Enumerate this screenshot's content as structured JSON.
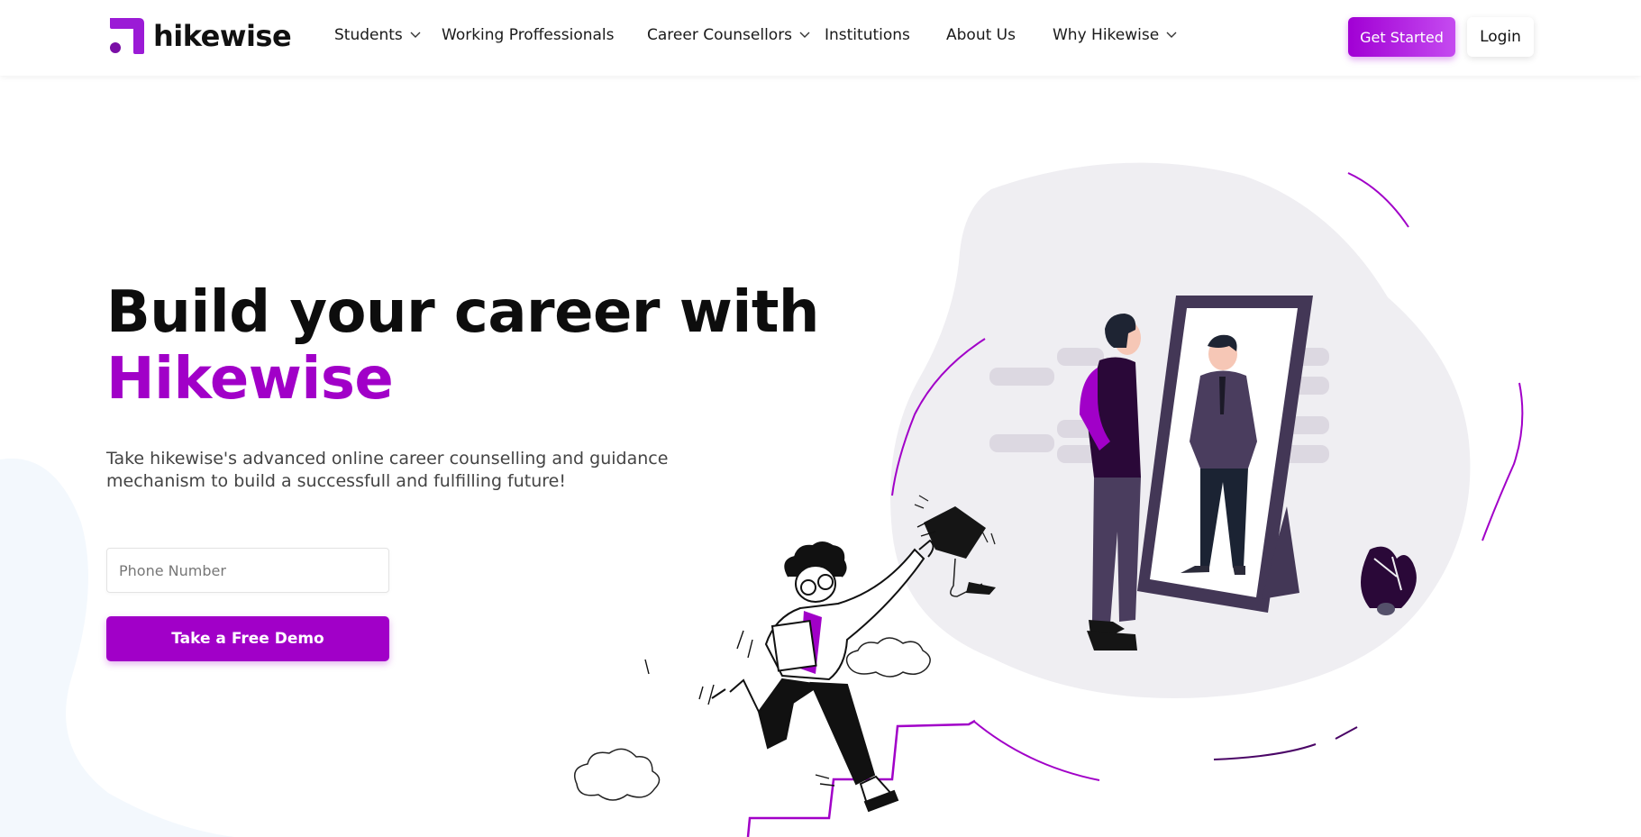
{
  "brand": {
    "name": "hikewise",
    "primary_color": "#a100c8",
    "logo_color": "#9b1bd6"
  },
  "nav": {
    "items": [
      {
        "label": "Students",
        "has_dropdown": true
      },
      {
        "label": "Working Proffessionals",
        "has_dropdown": false
      },
      {
        "label": "Career Counsellors",
        "has_dropdown": true
      },
      {
        "label": "Institutions",
        "has_dropdown": false
      },
      {
        "label": "About Us",
        "has_dropdown": false
      },
      {
        "label": "Why Hikewise",
        "has_dropdown": true
      }
    ],
    "get_started_label": "Get Started",
    "login_label": "Login"
  },
  "hero": {
    "headline_line1": "Build your career with",
    "headline_accent": "Hikewise",
    "subtext": "Take hikewise's advanced online career counselling and guidance mechanism to build a successfull and fulfilling future!",
    "phone_placeholder": "Phone Number",
    "demo_button_label": "Take a Free Demo"
  },
  "illustration": {
    "icons": [
      "student-running-icon",
      "graduation-cap-icon",
      "man-at-mirror-icon",
      "plant-icon",
      "cloud-icon",
      "stairs-icon"
    ]
  }
}
